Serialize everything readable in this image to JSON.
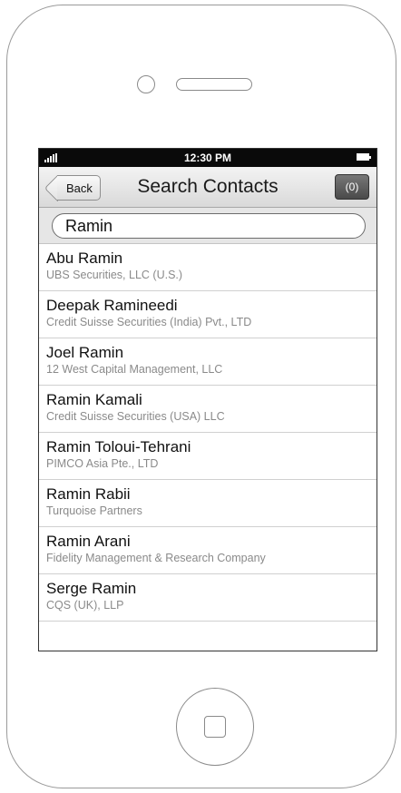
{
  "status_bar": {
    "time": "12:30 PM"
  },
  "nav": {
    "back_label": "Back",
    "title": "Search Contacts",
    "count_label": "(0)"
  },
  "search": {
    "value": "Ramin"
  },
  "contacts": [
    {
      "name": "Abu Ramin",
      "company": "UBS Securities, LLC (U.S.)"
    },
    {
      "name": "Deepak Ramineedi",
      "company": "Credit Suisse Securities (India) Pvt., LTD"
    },
    {
      "name": "Joel Ramin",
      "company": "12 West Capital Management, LLC"
    },
    {
      "name": "Ramin Kamali",
      "company": "Credit Suisse Securities (USA) LLC"
    },
    {
      "name": "Ramin Toloui-Tehrani",
      "company": "PIMCO Asia Pte., LTD"
    },
    {
      "name": "Ramin Rabii",
      "company": "Turquoise Partners"
    },
    {
      "name": "Ramin Arani",
      "company": "Fidelity Management & Research Company"
    },
    {
      "name": "Serge Ramin",
      "company": "CQS (UK), LLP"
    }
  ],
  "icons": {
    "signal": "signal-strength-icon",
    "battery": "battery-icon",
    "camera": "camera-icon",
    "speaker": "speaker-icon",
    "home": "home-button-icon"
  }
}
